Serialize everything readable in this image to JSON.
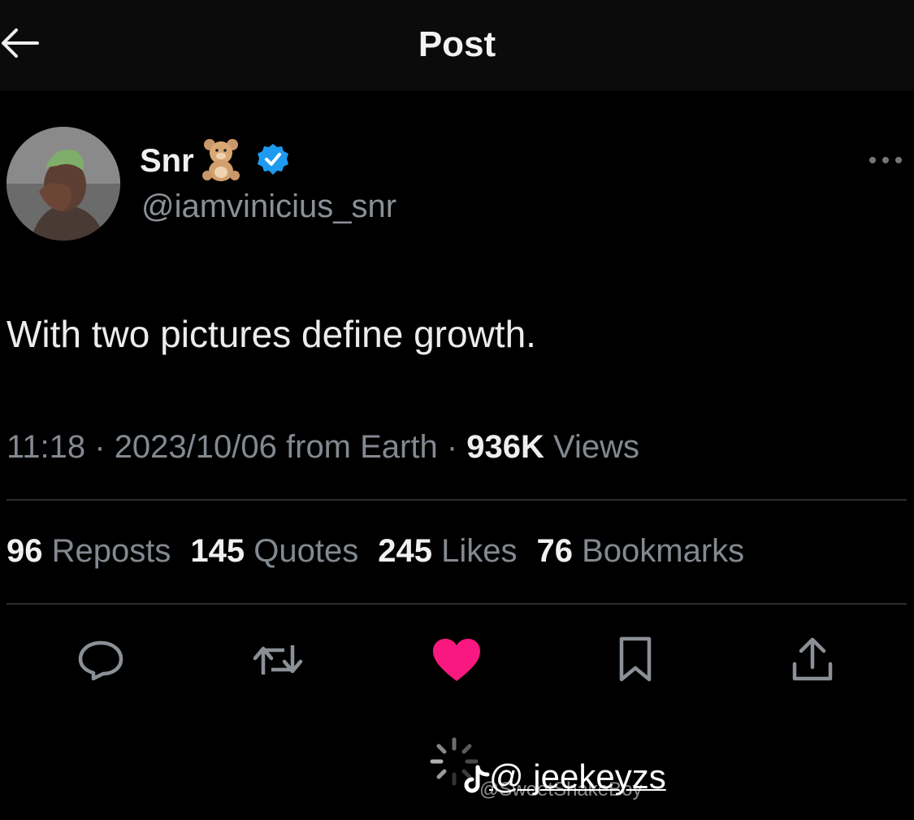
{
  "header": {
    "title": "Post",
    "back_icon": "arrow-left-icon"
  },
  "author": {
    "display_name": "Snr",
    "emoji": "teddy-bear-icon",
    "verified_icon": "verified-badge-icon",
    "handle": "@iamvinicius_snr",
    "more_icon": "more-horizontal-icon"
  },
  "tweet": {
    "text": "With two pictures define growth."
  },
  "meta": {
    "time": "11:18",
    "sep1": " · ",
    "date": "2023/10/06",
    "source": " from Earth",
    "sep2": " · ",
    "views_count": "936K",
    "views_label": " Views"
  },
  "stats": [
    {
      "count": "96",
      "label": "Reposts"
    },
    {
      "count": "145",
      "label": "Quotes"
    },
    {
      "count": "245",
      "label": "Likes"
    },
    {
      "count": "76",
      "label": "Bookmarks"
    }
  ],
  "actions": [
    "reply-icon",
    "repost-icon",
    "like-icon",
    "bookmark-icon",
    "share-icon"
  ],
  "colors": {
    "like": "#f9187f",
    "verified": "#1d9bf0",
    "muted": "#838990",
    "background": "#000000"
  },
  "watermark": {
    "handle": "@ jeekeyzs",
    "secondary": "@SweetShakeBoy"
  }
}
